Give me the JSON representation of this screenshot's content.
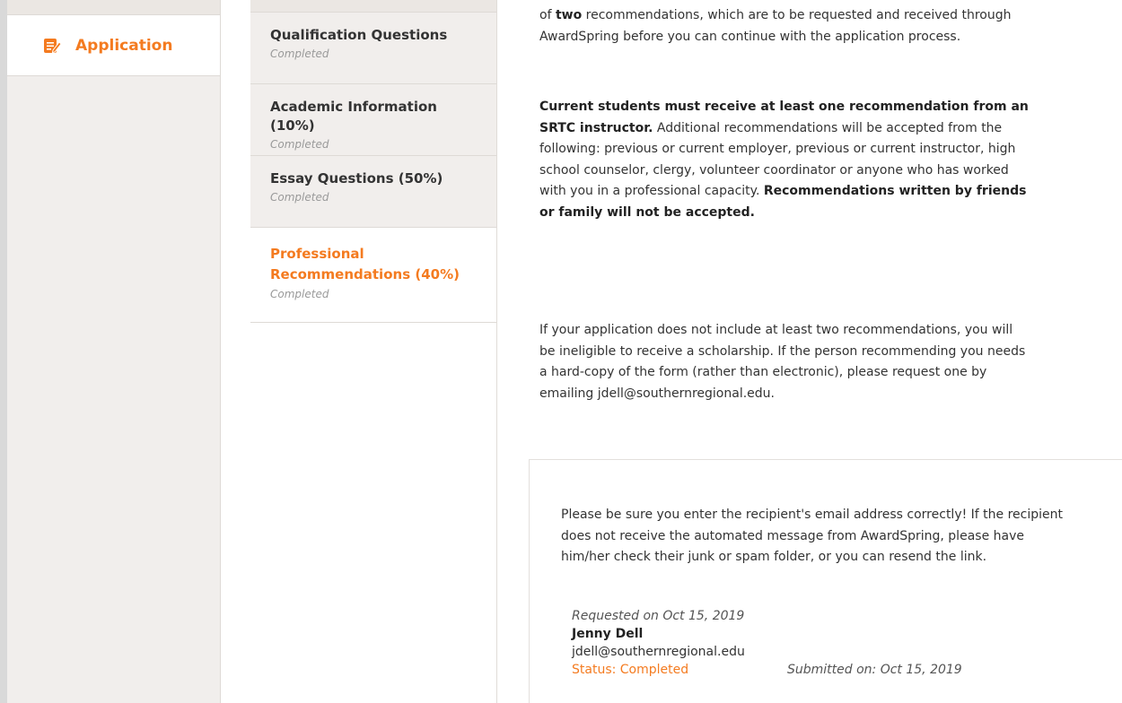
{
  "sidebar": {
    "active_item": {
      "label": "Application",
      "icon": "edit-form-icon"
    }
  },
  "steps": [
    {
      "title": "Qualification Questions",
      "status": "Completed"
    },
    {
      "title": "Academic Information (10%)",
      "status": "Completed"
    },
    {
      "title": "Essay Questions (50%)",
      "status": "Completed"
    },
    {
      "title": "Professional Recommendations (40%)",
      "status": "Completed",
      "active": true
    }
  ],
  "content": {
    "p1": {
      "pre": "of ",
      "bold": "two",
      "post": " recommendations, which are to be requested and received through AwardSpring before you can continue with the application process."
    },
    "p2": {
      "bold1": "Current students must receive at least one recommendation from an SRTC instructor.",
      "text": " Additional recommendations will be accepted from the following: previous or current employer, previous or current instructor, high school counselor, clergy, volunteer coordinator or anyone who has worked with you in a professional capacity. ",
      "bold2": "Recommendations written by friends or family will not be accepted."
    },
    "p3": "If your application does not include at least two recommendations, you will be ineligible to receive a scholarship. If the person recommending you needs a hard-copy of the form (rather than electronic), please request one by emailing jdell@southernregional.edu."
  },
  "notice": {
    "text": "Please be sure you enter the recipient's email address correctly! If the recipient does not receive the automated message from AwardSpring, please have him/her check their junk or spam folder, or you can resend the link."
  },
  "recommendation": {
    "requested": "Requested on Oct 15, 2019",
    "name": "Jenny Dell",
    "email": "jdell@southernregional.edu",
    "status": "Status: Completed",
    "submitted": "Submitted on: Oct 15, 2019"
  },
  "colors": {
    "accent": "#f47b20",
    "sidebar_bg": "#f1eeec"
  }
}
